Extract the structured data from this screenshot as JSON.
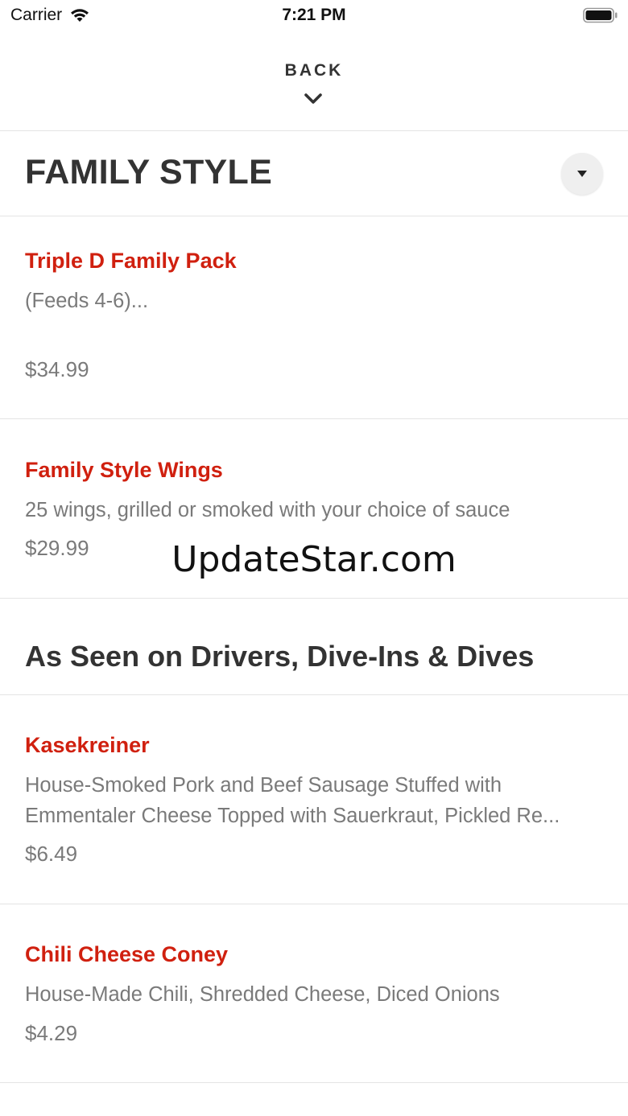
{
  "status_bar": {
    "carrier": "Carrier",
    "time": "7:21 PM"
  },
  "nav": {
    "back_label": "BACK"
  },
  "section": {
    "title": "FAMILY STYLE"
  },
  "items": [
    {
      "name": "Triple D Family Pack",
      "description": "(Feeds 4-6)...",
      "price": "$34.99"
    },
    {
      "name": "Family Style Wings",
      "description": "25 wings, grilled or smoked with your choice of sauce",
      "price": "$29.99"
    }
  ],
  "subsection": {
    "title": "As Seen on Drivers, Dive-Ins & Dives"
  },
  "sub_items": [
    {
      "name": "Kasekreiner",
      "description_line1": "House-Smoked Pork and Beef Sausage Stuffed with",
      "description_line2": "Emmentaler Cheese Topped with Sauerkraut, Pickled Re...",
      "price": "$6.49"
    },
    {
      "name": "Chili Cheese Coney",
      "description": "House-Made Chili, Shredded Cheese, Diced Onions",
      "price": "$4.29"
    }
  ],
  "watermark": "UpdateStar.com",
  "icons": {
    "wifi": "wifi-icon",
    "battery": "battery-icon",
    "back": "chevron-down-icon",
    "dropdown": "caret-down-icon"
  },
  "colors": {
    "accent": "#d0200f",
    "text_dark": "#333333",
    "text_muted": "#7a7a7a",
    "divider": "#e4e4e4"
  }
}
